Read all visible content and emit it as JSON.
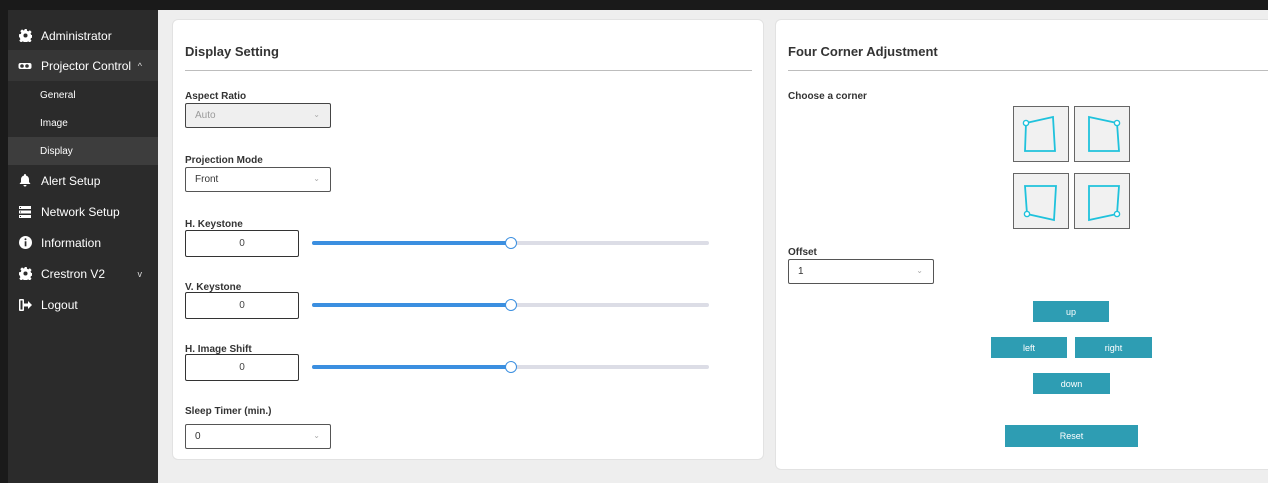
{
  "sidebar": {
    "items": [
      {
        "label": "Administrator",
        "icon": "gear-icon"
      },
      {
        "label": "Projector Control",
        "icon": "projector-icon",
        "chevron": "^"
      },
      {
        "label": "Alert Setup",
        "icon": "bell-icon"
      },
      {
        "label": "Network Setup",
        "icon": "network-icon"
      },
      {
        "label": "Information",
        "icon": "info-icon"
      },
      {
        "label": "Crestron V2",
        "icon": "gear-icon",
        "chevron": "v"
      },
      {
        "label": "Logout",
        "icon": "logout-icon"
      }
    ],
    "sub_items": [
      {
        "label": "General"
      },
      {
        "label": "Image"
      },
      {
        "label": "Display",
        "active": true
      }
    ]
  },
  "display_setting": {
    "title": "Display Setting",
    "aspect_ratio": {
      "label": "Aspect Ratio",
      "value": "Auto",
      "disabled": true
    },
    "projection_mode": {
      "label": "Projection Mode",
      "value": "Front"
    },
    "h_keystone": {
      "label": "H. Keystone",
      "value": "0",
      "slider_fraction": 0.5
    },
    "v_keystone": {
      "label": "V. Keystone",
      "value": "0",
      "slider_fraction": 0.5
    },
    "h_image_shift": {
      "label": "H. Image Shift",
      "value": "0",
      "slider_fraction": 0.5
    },
    "sleep_timer": {
      "label": "Sleep Timer (min.)",
      "value": "0"
    }
  },
  "four_corner": {
    "title": "Four Corner Adjustment",
    "choose_label": "Choose a corner",
    "corners": [
      "top-left",
      "top-right",
      "bottom-left",
      "bottom-right"
    ],
    "offset": {
      "label": "Offset",
      "value": "1"
    },
    "buttons": {
      "up": "up",
      "left": "left",
      "right": "right",
      "down": "down",
      "reset": "Reset"
    }
  },
  "colors": {
    "sidebar_bg": "#2b2b2b",
    "accent": "#2e9db3",
    "slider_fill": "#3b8fe0",
    "corner_shape": "#1fc2dc"
  }
}
